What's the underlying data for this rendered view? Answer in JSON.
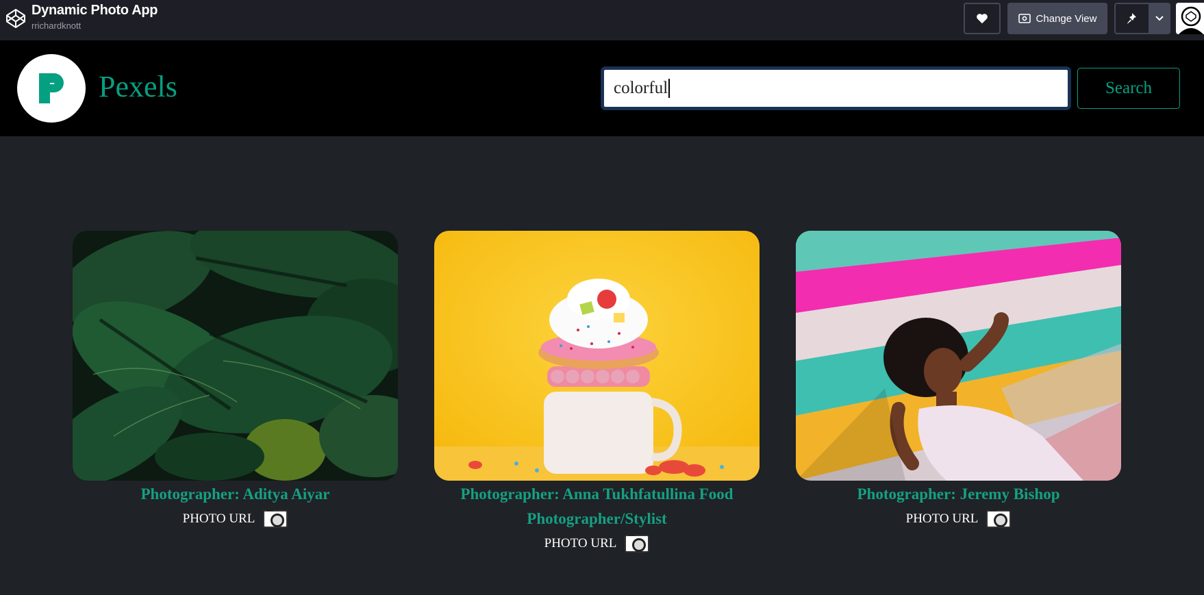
{
  "codepen": {
    "title": "Dynamic Photo App",
    "author": "rrichardknott",
    "change_view_label": "Change View"
  },
  "app": {
    "brand": "Pexels",
    "search": {
      "value": "colorful",
      "button_label": "Search"
    }
  },
  "photos": [
    {
      "photographer": "Photographer: Aditya Aiyar",
      "url_label": "PHOTO URL",
      "subject": "monstera leaves"
    },
    {
      "photographer": "Photographer: Anna Tukhfatullina Food Photographer/Stylist",
      "url_label": "PHOTO URL",
      "subject": "freakshake with donut"
    },
    {
      "photographer": "Photographer: Jeremy Bishop",
      "url_label": "PHOTO URL",
      "subject": "woman lying on colorful floor"
    }
  ],
  "colors": {
    "accent": "#05a081",
    "background": "#1f2226",
    "header": "#000000"
  }
}
